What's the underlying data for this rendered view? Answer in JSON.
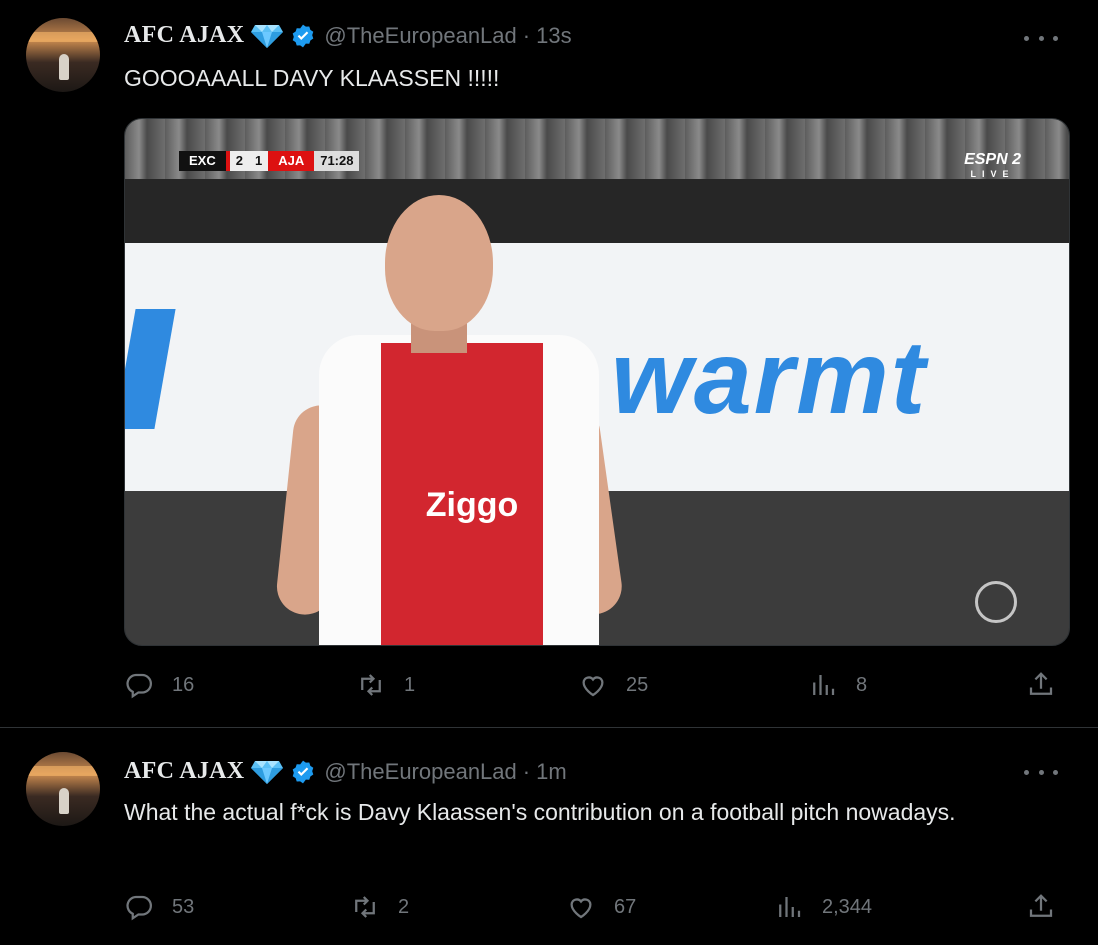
{
  "tweets": [
    {
      "display_name": "AFC AJAX",
      "handle": "@TheEuropeanLad",
      "separator": "·",
      "time": "13s",
      "text": "GOOOAAALL DAVY KLAASSEN !!!!!",
      "media": {
        "scorebug": {
          "team_home": "EXC",
          "score_home": "2",
          "score_away": "1",
          "team_away": "AJA",
          "clock": "71:28"
        },
        "broadcaster": "ESPN 2",
        "broadcaster_sub": "LIVE",
        "sponsor": "Ziggo",
        "board_text": "warmt"
      },
      "actions": {
        "replies": "16",
        "retweets": "1",
        "likes": "25",
        "views": "8"
      }
    },
    {
      "display_name": "AFC AJAX",
      "handle": "@TheEuropeanLad",
      "separator": "·",
      "time": "1m",
      "text": "What the actual f*ck is Davy Klaassen's contribution on a football pitch nowadays.",
      "actions": {
        "replies": "53",
        "retweets": "2",
        "likes": "67",
        "views": "2,344"
      }
    }
  ],
  "icons": {
    "badge": "diamond-icon",
    "verified": "verified-icon",
    "more": "more-icon",
    "reply": "reply-icon",
    "retweet": "retweet-icon",
    "like": "like-icon",
    "views": "views-icon",
    "share": "share-icon"
  },
  "colors": {
    "background": "#000000",
    "text": "#e7e9ea",
    "muted": "#71767b",
    "verified": "#1d9bf0",
    "diamond": "#5bc0f5",
    "divider": "#2f3336"
  }
}
